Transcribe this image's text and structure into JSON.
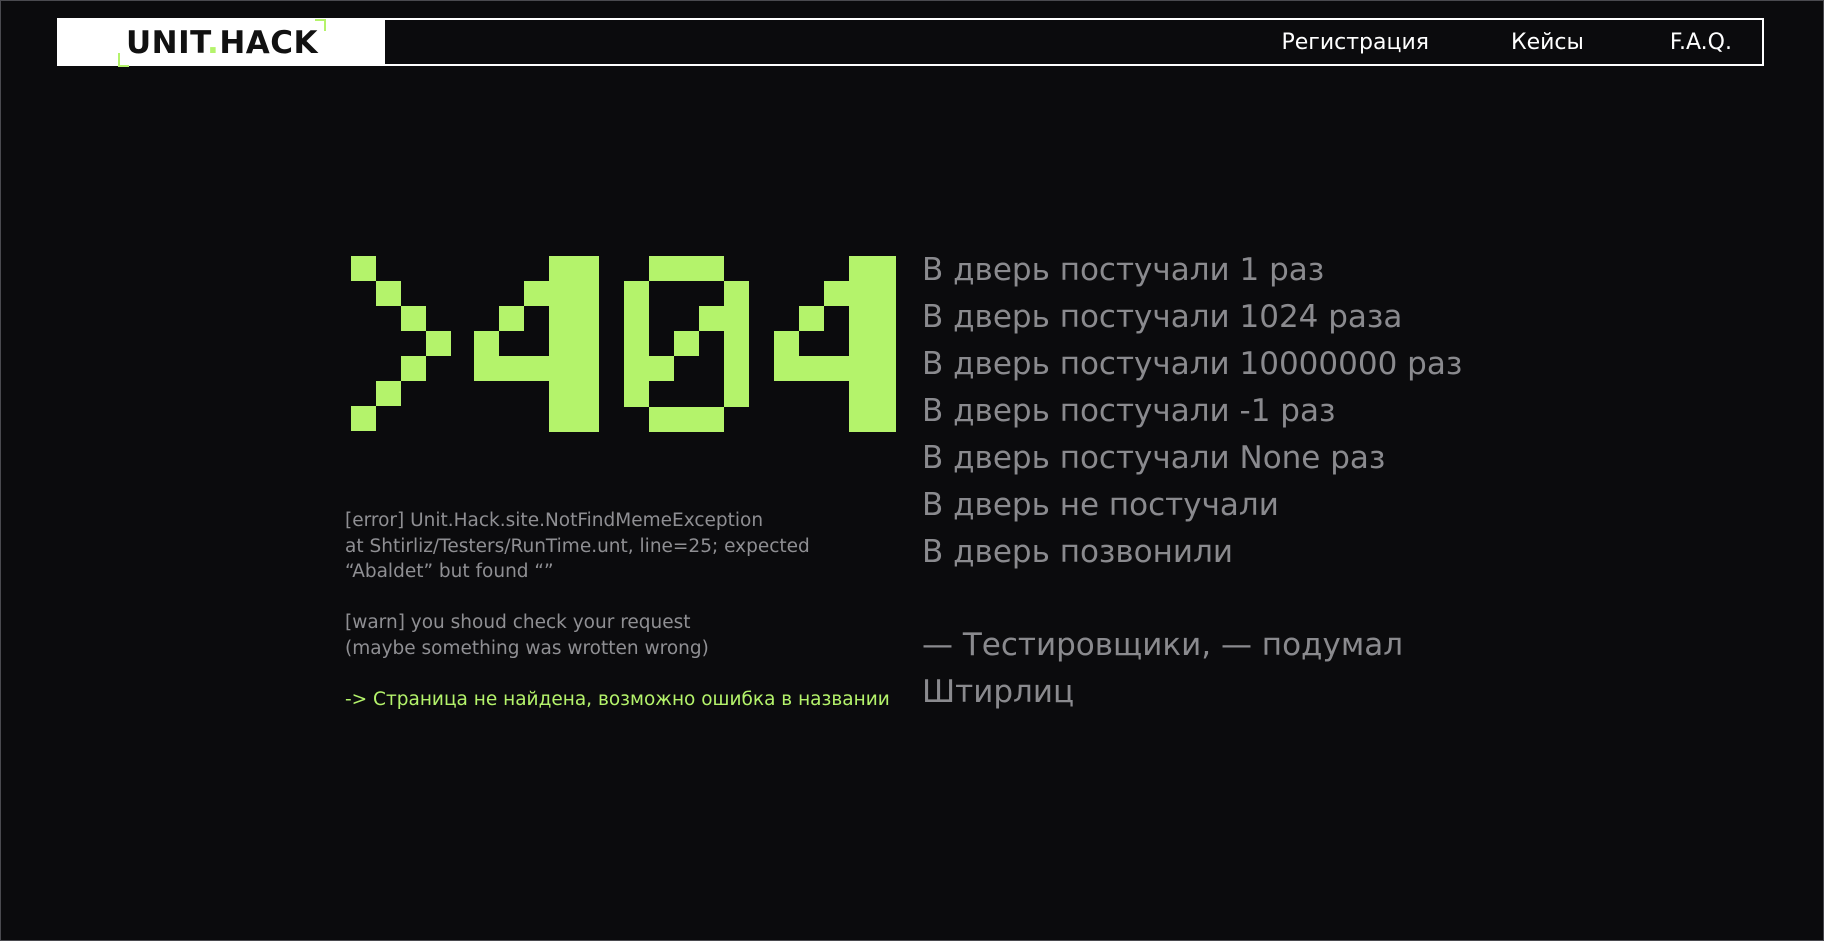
{
  "header": {
    "logo_text_left": "UNIT",
    "logo_dot": ".",
    "logo_text_right": "HACK",
    "nav": [
      {
        "label": "Регистрация"
      },
      {
        "label": "Кейсы"
      },
      {
        "label": "F.A.Q."
      }
    ]
  },
  "hero": {
    "code_art": ">404",
    "accent_color": "#b4f36b"
  },
  "log": {
    "error_line1": "[error] Unit.Hack.site.NotFindMemeException",
    "error_line2": "at Shtirliz/Testers/RunTime.unt, line=25; expected",
    "error_line3": "“Abaldet” but found “”",
    "warn_line1": "[warn] you shoud check your request",
    "warn_line2": "(maybe something was wrotten wrong)",
    "hint": "-> Страница не найдена, возможно ошибка в названии"
  },
  "knocks": [
    "В дверь постучали 1 раз",
    "В дверь постучали 1024 раза",
    "В дверь постучали 10000000 раз",
    "В дверь постучали -1 раз",
    "В дверь постучали None раз",
    "В дверь не постучали",
    "В дверь позвонили"
  ],
  "quote": {
    "line1": "— Тестировщики, —  подумал",
    "line2": "Штирлиц"
  }
}
